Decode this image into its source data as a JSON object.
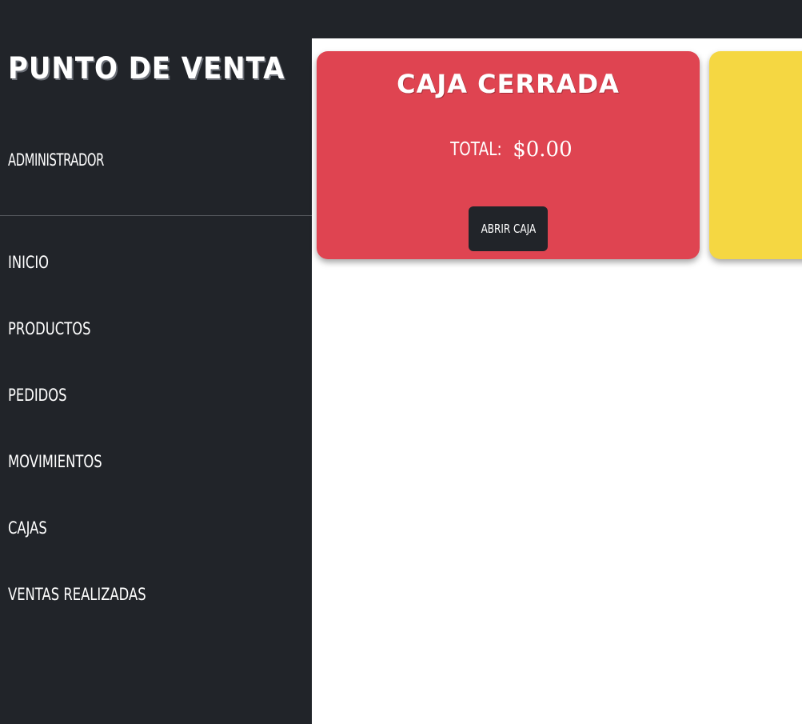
{
  "sidebar": {
    "brand": "PUNTO DE VENTA",
    "user": "ADMINISTRADOR",
    "items": [
      {
        "label": "INICIO"
      },
      {
        "label": "PRODUCTOS"
      },
      {
        "label": "PEDIDOS"
      },
      {
        "label": "MOVIMIENTOS"
      },
      {
        "label": "CAJAS"
      },
      {
        "label": "VENTAS REALIZADAS"
      }
    ]
  },
  "cards": {
    "register": {
      "title": "CAJA CERRADA",
      "total_label": "TOTAL:",
      "total_value": "$0.00",
      "button_label": "ABRIR CAJA",
      "color": "#df4451"
    },
    "secondary": {
      "color": "#f5d742"
    }
  },
  "colors": {
    "sidebar_bg": "#212429",
    "content_bg": "#ffffff",
    "button_bg": "#212429"
  }
}
